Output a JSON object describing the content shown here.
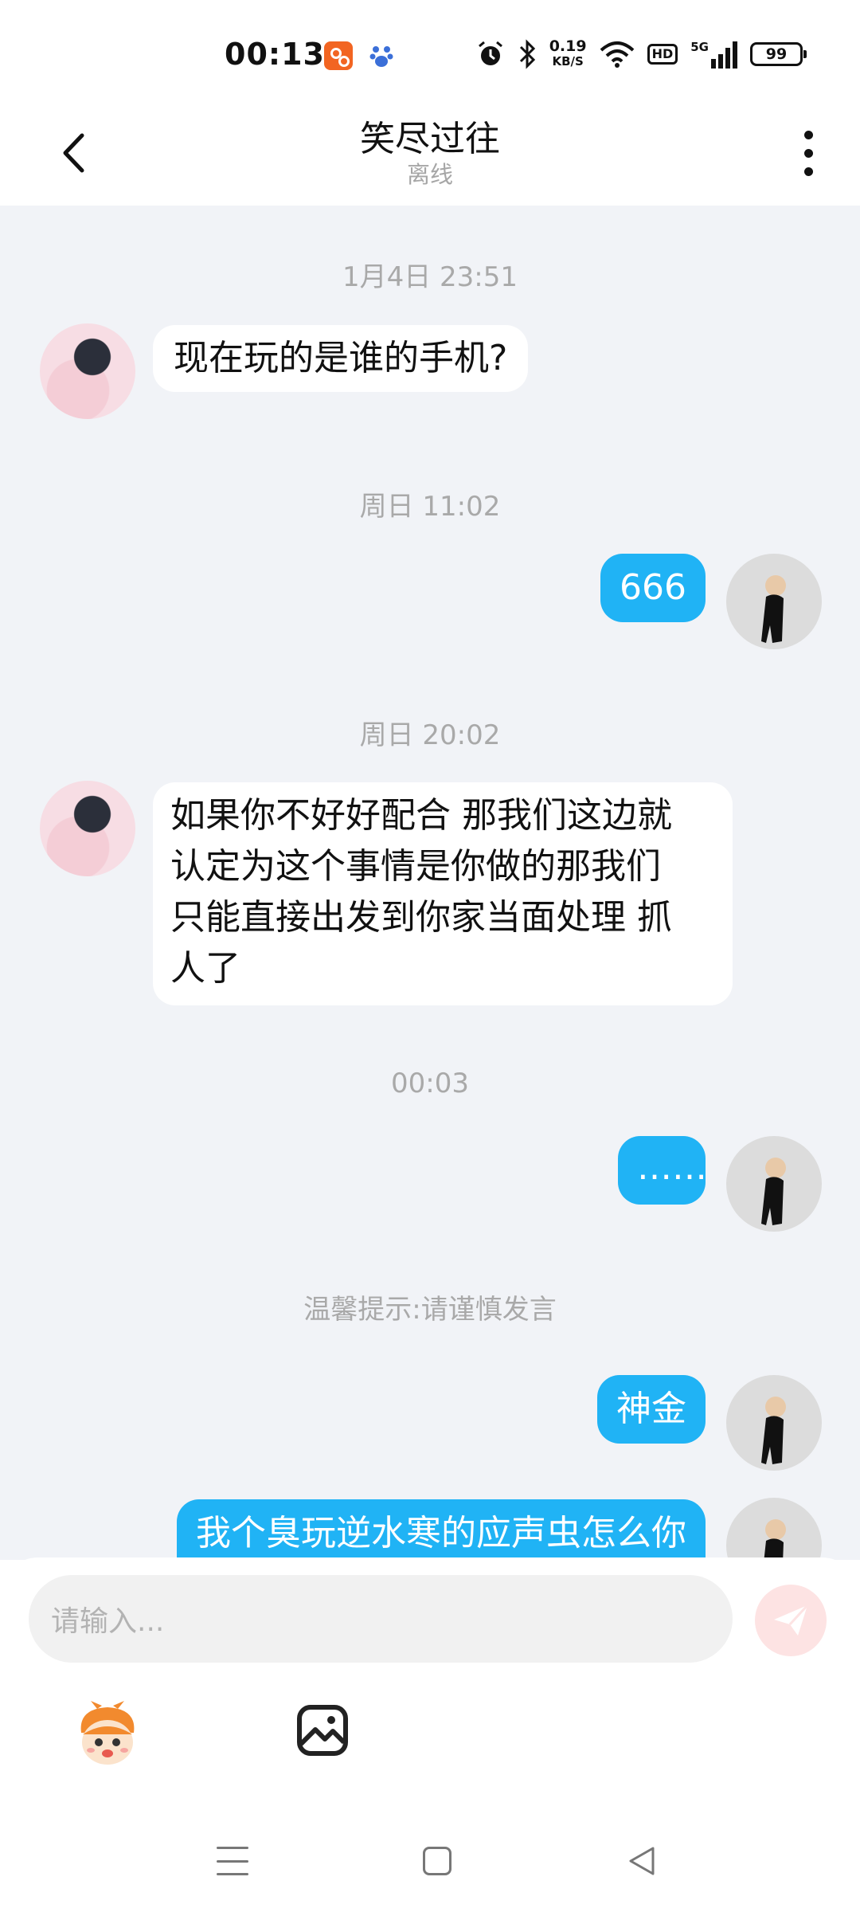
{
  "status_bar": {
    "time": "00:13",
    "net_speed_value": "0.19",
    "net_speed_unit": "KB/S",
    "hd_label": "HD",
    "network_label": "5G",
    "battery": "99"
  },
  "header": {
    "title": "笑尽过往",
    "status": "离线"
  },
  "messages": [
    {
      "type": "timestamp",
      "text": "1月4日 23:51"
    },
    {
      "type": "received",
      "text": "现在玩的是谁的手机?"
    },
    {
      "type": "timestamp",
      "text": "周日 11:02"
    },
    {
      "type": "sent",
      "text": "666"
    },
    {
      "type": "timestamp",
      "text": "周日 20:02"
    },
    {
      "type": "received",
      "lines": [
        "如果你不好好配合 那我们这边就",
        "认定为这个事情是你做的那我们",
        "只能直接出发到你家当面处理 抓",
        "人了"
      ]
    },
    {
      "type": "timestamp",
      "text": "00:03"
    },
    {
      "type": "sent",
      "text": "……"
    },
    {
      "type": "system",
      "text": "温馨提示:请谨慎发言"
    },
    {
      "type": "sent",
      "text": "神金"
    },
    {
      "type": "sent",
      "text": "我个臭玩逆水寒的应声虫怎么你"
    }
  ],
  "input": {
    "placeholder": "请输入..."
  },
  "colors": {
    "sent_bubble": "#20b3f5",
    "chat_background": "#f1f3f7",
    "send_button": "#fde3e3"
  }
}
